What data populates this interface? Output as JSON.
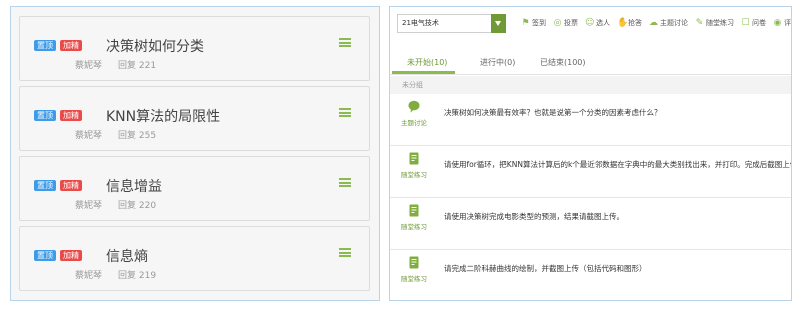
{
  "topics": [
    {
      "badge_top": "置顶",
      "badge_hot": "加精",
      "title": "决策树如何分类",
      "author": "蔡妮琴",
      "reply_label": "回复",
      "reply_count": "221"
    },
    {
      "badge_top": "置顶",
      "badge_hot": "加精",
      "title": "KNN算法的局限性",
      "author": "蔡妮琴",
      "reply_label": "回复",
      "reply_count": "255"
    },
    {
      "badge_top": "置顶",
      "badge_hot": "加精",
      "title": "信息增益",
      "author": "蔡妮琴",
      "reply_label": "回复",
      "reply_count": "220"
    },
    {
      "badge_top": "置顶",
      "badge_hot": "加精",
      "title": "信息熵",
      "author": "蔡妮琴",
      "reply_label": "回复",
      "reply_count": "219"
    }
  ],
  "toolbar": {
    "class_selected": "21电气技术",
    "items": [
      {
        "icon": "pin-icon",
        "label": "签到"
      },
      {
        "icon": "vote-icon",
        "label": "投票"
      },
      {
        "icon": "person-icon",
        "label": "选人"
      },
      {
        "icon": "hand-icon",
        "label": "抢答"
      },
      {
        "icon": "chat-icon",
        "label": "主题讨论"
      },
      {
        "icon": "note-icon",
        "label": "随堂练习"
      },
      {
        "icon": "question-icon",
        "label": "问卷"
      },
      {
        "icon": "rating-icon",
        "label": "评分"
      }
    ]
  },
  "tabs": [
    {
      "label": "未开始(10)",
      "active": true
    },
    {
      "label": "进行中(0)",
      "active": false
    },
    {
      "label": "已结束(100)",
      "active": false
    }
  ],
  "group_label": "未分组",
  "activities": [
    {
      "icon": "chat-icon",
      "type": "主题讨论",
      "text": "决策树如何决策最有效率？也就是说第一个分类的因素考虑什么？"
    },
    {
      "icon": "note-icon",
      "type": "随堂练习",
      "text": "请使用for循环，把KNN算法计算后的k个最近邻数据在字典中的最大类别找出来，并打印。完成后截图上传"
    },
    {
      "icon": "note-icon",
      "type": "随堂练习",
      "text": "请使用决策树完成电影类型的预测，结果请截图上传。"
    },
    {
      "icon": "note-icon",
      "type": "随堂练习",
      "text": "请完成二阶科赫曲线的绘制，并截图上传（包括代码和图形）"
    }
  ],
  "colors": {
    "accent_green": "#8bbb4f",
    "badge_blue": "#3d9be9",
    "badge_red": "#e94b4b",
    "border_blue": "#b9d3ea"
  }
}
